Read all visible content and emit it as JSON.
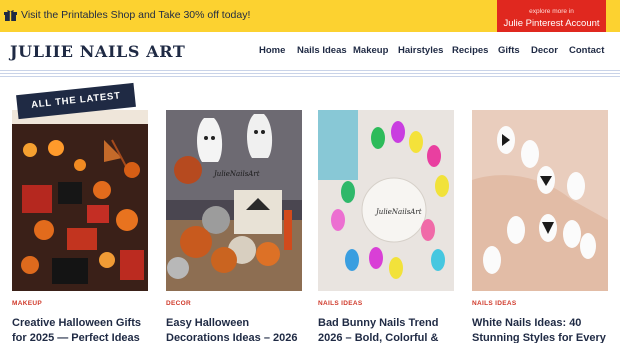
{
  "promo": {
    "text": "Visit the Printables Shop and Take 30% off today!"
  },
  "pinterest": {
    "small": "explore more in",
    "label": "Julie Pinterest Account"
  },
  "site": {
    "logo": "JULIIE NAILS ART"
  },
  "nav": {
    "home": "Home",
    "nails": "Nails Ideas",
    "makeup": "Makeup",
    "hairstyles": "Hairstyles",
    "recipes": "Recipes",
    "gifts": "Gifts",
    "decor": "Decor",
    "contact": "Contact"
  },
  "latest": {
    "badge": "ALL THE LATEST"
  },
  "posts": [
    {
      "category": "MAKEUP",
      "title_line1": "Creative Halloween Gifts",
      "title_line2": "for 2025 — Perfect Ideas"
    },
    {
      "category": "DECOR",
      "title_line1": "Easy Halloween",
      "title_line2": "Decorations Ideas – 2026",
      "image_caption": "JulieNailsArt"
    },
    {
      "category": "NAILS IDEAS",
      "title_line1": "Bad Bunny Nails Trend",
      "title_line2": "2026 – Bold, Colorful &",
      "image_caption": "JulieNailsArt"
    },
    {
      "category": "NAILS IDEAS",
      "title_line1": "White Nails Ideas: 40",
      "title_line2": "Stunning Styles for Every"
    }
  ],
  "colors": {
    "promo_bg": "#fcd230",
    "pinterest_red": "#e0281f",
    "navy": "#1f2a44",
    "category_red": "#d03a2b"
  },
  "icons": {
    "promo": "gift-icon"
  }
}
